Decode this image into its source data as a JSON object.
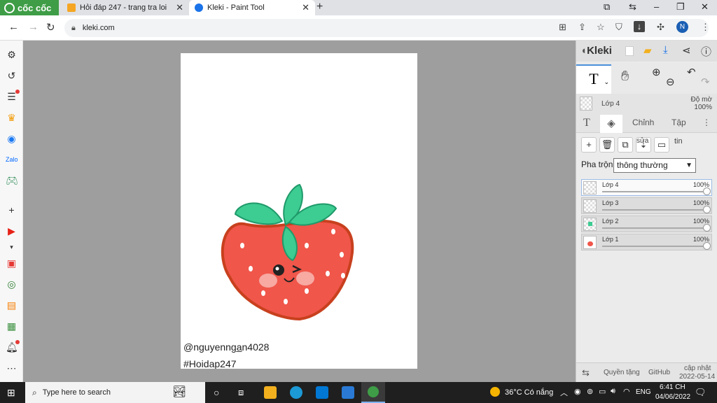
{
  "browser": {
    "brand": "cốc cốc",
    "tabs": [
      {
        "title": "Hỏi đáp 247 - trang tra loi",
        "active": false
      },
      {
        "title": "Kleki - Paint Tool",
        "active": true
      }
    ],
    "url": "kleki.com",
    "avatar_letter": "N"
  },
  "canvas": {
    "watermark_line1": "@nguyennga̲n4028",
    "watermark_line2": "#Hoidap247"
  },
  "kleki": {
    "logo": "Kleki",
    "current_layer": "Lớp 4",
    "opacity_label": "Độ mờ",
    "opacity_value": "100%",
    "tabs": {
      "adjust": "Chỉnh",
      "file": "Tập"
    },
    "edit_label": "sửa",
    "tin_label": "tin",
    "blend_label": "Pha trộn",
    "blend_value": "thông thường",
    "layers": [
      {
        "name": "Lớp 4",
        "opacity": "100%",
        "selected": true
      },
      {
        "name": "Lớp 3",
        "opacity": "100%",
        "selected": false
      },
      {
        "name": "Lớp 2",
        "opacity": "100%",
        "selected": false
      },
      {
        "name": "Lớp 1",
        "opacity": "100%",
        "selected": false
      }
    ],
    "footer": {
      "privacy": "Quyền tặng",
      "github": "GitHub",
      "update_label": "cập nhật",
      "update_date": "2022-05-14"
    }
  },
  "taskbar": {
    "search_placeholder": "Type here to search",
    "weather": "36°C  Có nắng",
    "lang": "ENG",
    "time": "6:41 CH",
    "date": "04/06/2022"
  },
  "colors": {
    "brand_green": "#3e9d46",
    "accent_blue": "#4a90d9",
    "strawberry": "#f0564a",
    "leaf": "#3dcc92"
  }
}
